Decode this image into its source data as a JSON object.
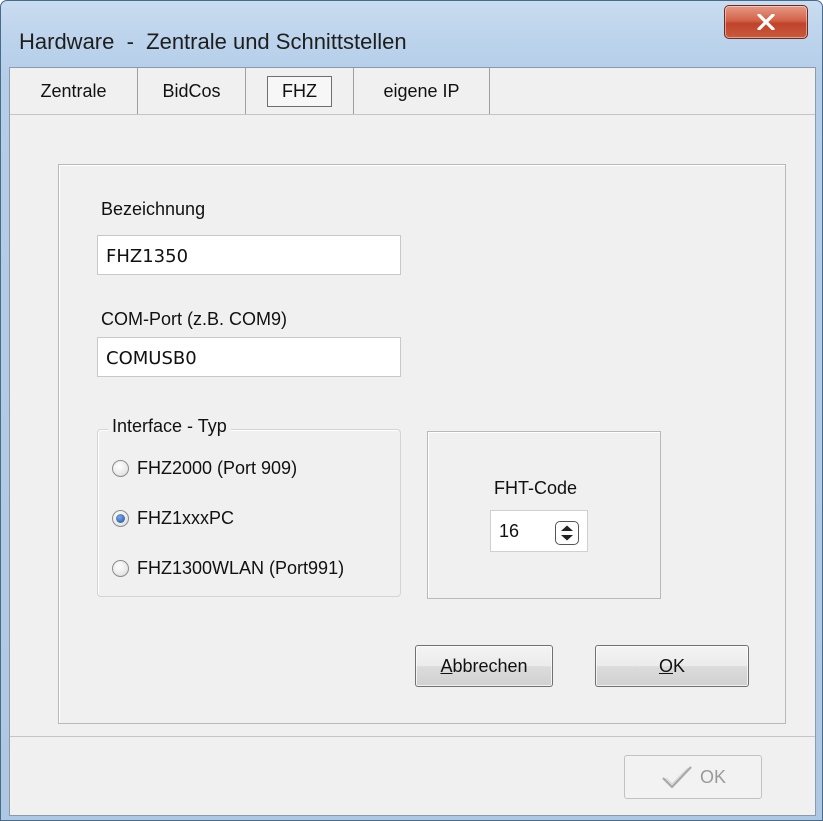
{
  "window": {
    "title": "Hardware  -  Zentrale und Schnittstellen",
    "close_symbol": "x"
  },
  "tabs": [
    {
      "label": "Zentrale"
    },
    {
      "label": "BidCos"
    },
    {
      "label": "FHZ",
      "selected": true
    },
    {
      "label": "eigene IP"
    }
  ],
  "form": {
    "bezeichnung_label": "Bezeichnung",
    "bezeichnung_value": "FHZ1350",
    "comport_label": "COM-Port (z.B. COM9)",
    "comport_value": "COMUSB0"
  },
  "interface": {
    "title": "Interface - Typ",
    "options": [
      {
        "label": "FHZ2000 (Port 909)",
        "checked": false
      },
      {
        "label": "FHZ1xxxPC",
        "checked": true
      },
      {
        "label": "FHZ1300WLAN (Port991)",
        "checked": false
      }
    ]
  },
  "fht": {
    "label": "FHT-Code",
    "value": "16"
  },
  "buttons": {
    "abbrechen_first": "A",
    "abbrechen_rest": "bbrechen",
    "ok_first": "O",
    "ok_rest": "K",
    "footer_ok": "OK"
  },
  "icons": {
    "close": "close-icon",
    "checkmark": "checkmark-icon",
    "spin": "spin-updown-icon"
  },
  "colors": {
    "close_button": "#c8553c",
    "client_bg": "#f0f0f0",
    "title_gradient": "#bcd3ec"
  }
}
